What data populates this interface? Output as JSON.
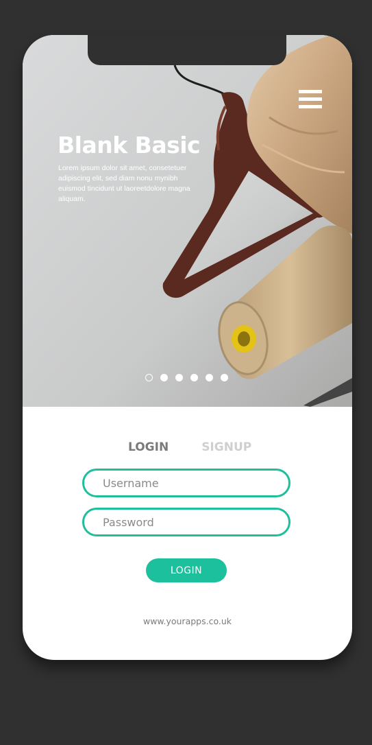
{
  "hero": {
    "title": "Blank Basic",
    "text": "Lorem ipsum dolor sit amet, consetetuer adipiscing elit, sed diam nonu mynibh euismod tincidunt ut laoreetdolore magna aliquam.",
    "image_subject": "clothes hanger, fabric and thread spool"
  },
  "carousel": {
    "count": 6,
    "active_index": 0
  },
  "tabs": [
    {
      "label": "LOGIN",
      "active": true
    },
    {
      "label": "SIGNUP",
      "active": false
    }
  ],
  "form": {
    "username_placeholder": "Username",
    "password_placeholder": "Password",
    "submit_label": "LOGIN"
  },
  "footer": {
    "url": "www.yourapps.co.uk"
  },
  "colors": {
    "accent": "#1cc09c",
    "background": "#303030",
    "card": "#ffffff"
  },
  "icons": {
    "menu": "hamburger-menu-icon"
  }
}
